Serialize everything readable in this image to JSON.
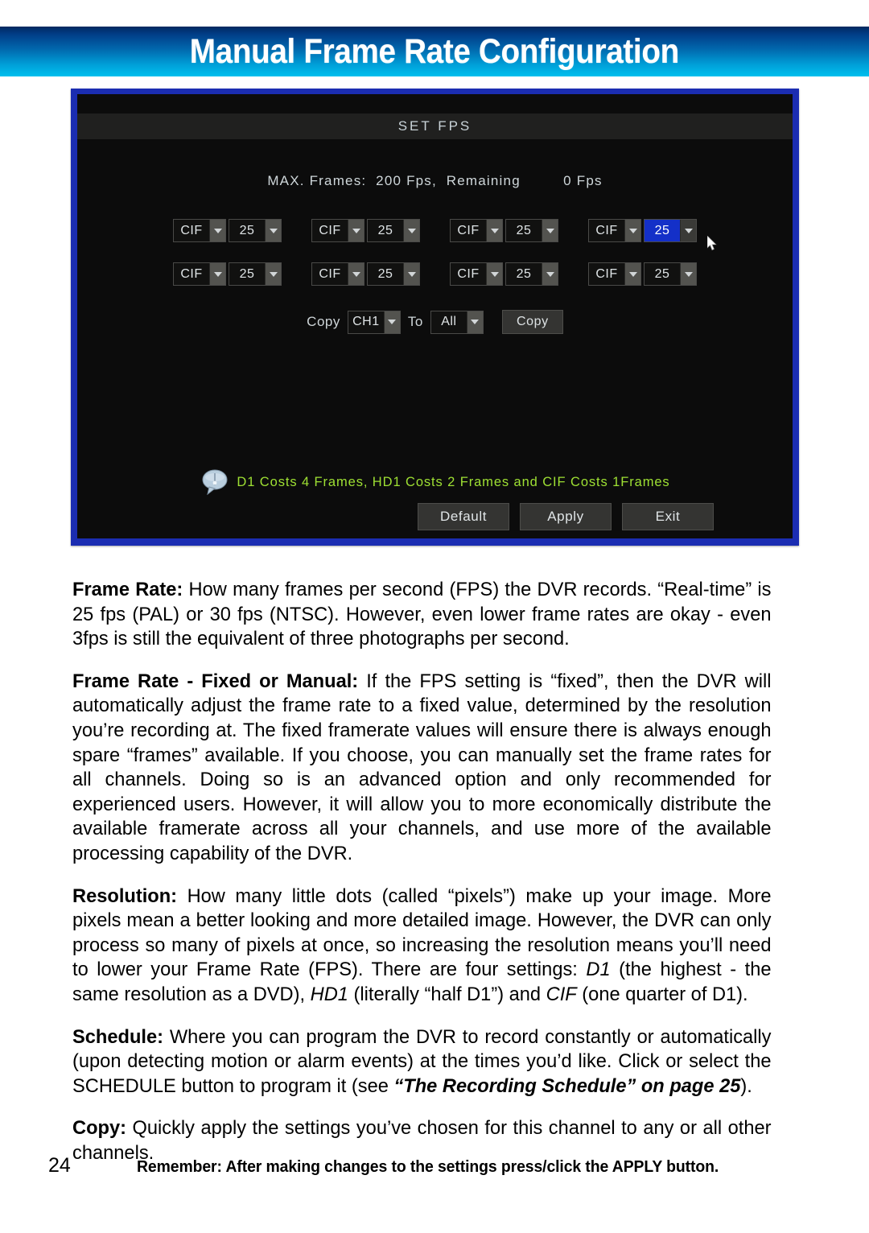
{
  "header": {
    "title": "Manual Frame Rate Configuration",
    "gradient_top": "#01285f",
    "gradient_bottom": "#00c0ee"
  },
  "dvr": {
    "border_color": "#1b2db2",
    "screen_color": "#0c0c0c",
    "window_title": "SET FPS",
    "max_frames_line": "MAX. Frames:  200 Fps,  Remaining         0 Fps",
    "channels_row_1": [
      {
        "resolution": "CIF",
        "fps": "25",
        "highlighted": false
      },
      {
        "resolution": "CIF",
        "fps": "25",
        "highlighted": false
      },
      {
        "resolution": "CIF",
        "fps": "25",
        "highlighted": false
      },
      {
        "resolution": "CIF",
        "fps": "25",
        "highlighted": true
      }
    ],
    "channels_row_2": [
      {
        "resolution": "CIF",
        "fps": "25",
        "highlighted": false
      },
      {
        "resolution": "CIF",
        "fps": "25",
        "highlighted": false
      },
      {
        "resolution": "CIF",
        "fps": "25",
        "highlighted": false
      },
      {
        "resolution": "CIF",
        "fps": "25",
        "highlighted": false
      }
    ],
    "copy": {
      "label": "Copy",
      "source_channel": "CH1",
      "to_label": "To",
      "target": "All",
      "button_label": "Copy"
    },
    "hint": {
      "icon": "info-bubble-icon",
      "text": "D1 Costs 4 Frames, HD1 Costs 2 Frames and CIF Costs 1Frames",
      "color": "#9ee033"
    },
    "buttons": {
      "default": "Default",
      "apply": "Apply",
      "exit": "Exit"
    },
    "highlight_color": "#1430c8"
  },
  "body": {
    "p1_heading": "Frame Rate:",
    "p1_text": " How many frames per second (FPS) the DVR records. “Real-time” is 25 fps (PAL) or 30 fps (NTSC). However, even lower frame rates are okay - even 3fps is still the equivalent of three photographs per second.",
    "p2_heading": "Frame Rate - Fixed or Manual:",
    "p2_text": " If the FPS setting is “fixed”, then the DVR will automatically adjust the frame rate to a fixed value, determined by the resolution you’re recording at. The fixed framerate values will ensure there is always enough spare “frames” available. If you choose, you can manually set the frame rates for all channels. Doing so is an advanced option and only recommended for experienced users. However, it will allow you to more economically distribute the available framerate across all your channels, and use more of the available processing capability of the DVR.",
    "p3_heading": "Resolution:",
    "p3_text_a": " How many little dots (called “pixels”) make up your image. More pixels mean a better looking and more detailed image. However, the DVR can only process so many of pixels at once, so increasing the resolution means you’ll need to lower your Frame Rate (FPS). There are four settings: ",
    "p3_em_1": "D1",
    "p3_text_b": " (the highest - the same resolution as a DVD), ",
    "p3_em_2": "HD1",
    "p3_text_c": " (literally “half D1”) and ",
    "p3_em_3": "CIF",
    "p3_text_d": " (one quarter of D1).",
    "p4_heading": "Schedule:",
    "p4_text_a": " Where you can program the DVR to record constantly or automatically (upon detecting motion or alarm events) at the times you’d like. Click or select the SCHEDULE button to program it (see ",
    "p4_ref": "“The Recording Schedule” on page 25",
    "p4_text_b": ").",
    "p5_heading": "Copy:",
    "p5_text": " Quickly apply the settings you’ve chosen for this channel to any or all other channels."
  },
  "footer": {
    "page_number": "24",
    "note": "Remember: After making changes to the settings press/click the APPLY button."
  }
}
